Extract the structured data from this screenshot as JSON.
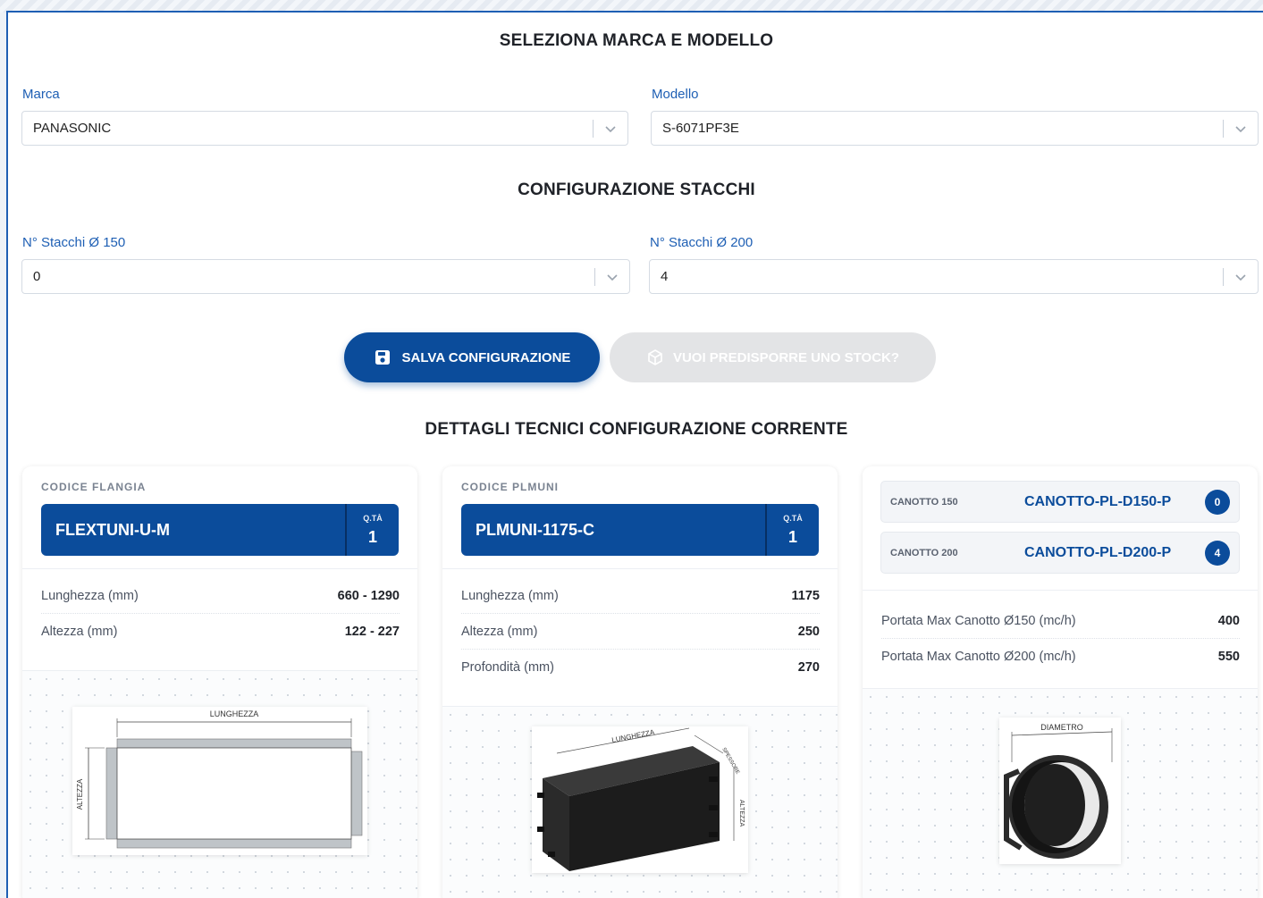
{
  "section_titles": {
    "brand_model": "SELEZIONA MARCA E MODELLO",
    "config": "CONFIGURAZIONE STACCHI",
    "details": "DETTAGLI TECNICI CONFIGURAZIONE CORRENTE"
  },
  "fields": {
    "marca": {
      "label": "Marca",
      "value": "PANASONIC"
    },
    "modello": {
      "label": "Modello",
      "value": "S-6071PF3E"
    },
    "stacchi150": {
      "label": "N° Stacchi Ø 150",
      "value": "0"
    },
    "stacchi200": {
      "label": "N° Stacchi Ø 200",
      "value": "4"
    }
  },
  "buttons": {
    "save": "SALVA CONFIGURAZIONE",
    "stock": "VUOI PREDISPORRE UNO STOCK?"
  },
  "cards": {
    "flangia": {
      "kicker": "CODICE FLANGIA",
      "code": "FLEXTUNI-U-M",
      "qty_label": "Q.TÀ",
      "qty": "1",
      "specs": [
        {
          "label": "Lunghezza (mm)",
          "value": "660 - 1290"
        },
        {
          "label": "Altezza (mm)",
          "value": "122 - 227"
        }
      ],
      "diagram_labels": {
        "length": "LUNGHEZZA",
        "height": "ALTEZZA"
      }
    },
    "plmuni": {
      "kicker": "CODICE PLMUNI",
      "code": "PLMUNI-1175-C",
      "qty_label": "Q.TÀ",
      "qty": "1",
      "specs": [
        {
          "label": "Lunghezza (mm)",
          "value": "1175"
        },
        {
          "label": "Altezza (mm)",
          "value": "250"
        },
        {
          "label": "Profondità (mm)",
          "value": "270"
        }
      ],
      "diagram_labels": {
        "length": "LUNGHEZZA",
        "height": "ALTEZZA",
        "depth": "SPESSORE"
      }
    },
    "canotti": {
      "rows": [
        {
          "label": "CANOTTO 150",
          "code": "CANOTTO-PL-D150-P",
          "qty": "0"
        },
        {
          "label": "CANOTTO 200",
          "code": "CANOTTO-PL-D200-P",
          "qty": "4"
        }
      ],
      "specs": [
        {
          "label": "Portata Max Canotto Ø150 (mc/h)",
          "value": "400"
        },
        {
          "label": "Portata Max Canotto Ø200 (mc/h)",
          "value": "550"
        }
      ],
      "diagram_labels": {
        "diameter": "DIAMETRO"
      }
    }
  },
  "colors": {
    "primary": "#0b4c9b",
    "label_blue": "#1e5fb4",
    "disabled": "#e3e4e6"
  }
}
